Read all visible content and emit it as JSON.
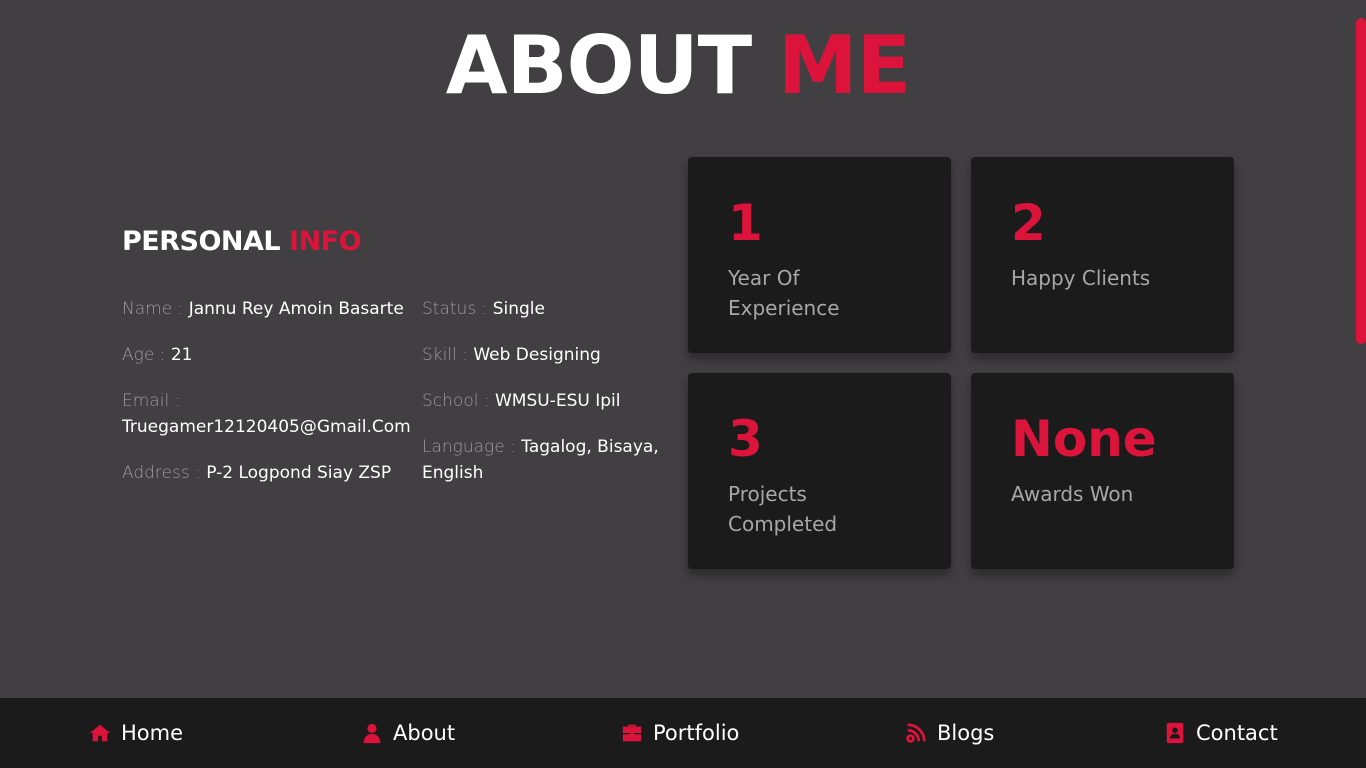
{
  "title": {
    "part1": "ABOUT",
    "part2": "ME"
  },
  "personal_info": {
    "heading_part1": "PERSONAL",
    "heading_part2": "INFO",
    "left": [
      {
        "key": "Name :",
        "value": "Jannu Rey Amoin Basarte"
      },
      {
        "key": "Age :",
        "value": "21"
      },
      {
        "key": "Email :",
        "value": "Truegamer12120405@Gmail.Com"
      },
      {
        "key": "Address :",
        "value": "P-2 Logpond Siay ZSP"
      }
    ],
    "right": [
      {
        "key": "Status :",
        "value": "Single"
      },
      {
        "key": "Skill :",
        "value": "Web Designing"
      },
      {
        "key": "School :",
        "value": "WMSU-ESU Ipil"
      },
      {
        "key": "Language :",
        "value": "Tagalog, Bisaya, English"
      }
    ]
  },
  "stats": [
    {
      "number": "1",
      "label": "Year Of Experience"
    },
    {
      "number": "2",
      "label": "Happy Clients"
    },
    {
      "number": "3",
      "label": "Projects Completed"
    },
    {
      "number": "None",
      "label": "Awards Won"
    }
  ],
  "nav": [
    {
      "label": "Home",
      "icon": "home-icon"
    },
    {
      "label": "About",
      "icon": "user-icon"
    },
    {
      "label": "Portfolio",
      "icon": "briefcase-icon"
    },
    {
      "label": "Blogs",
      "icon": "blog-icon"
    },
    {
      "label": "Contact",
      "icon": "address-book-icon"
    }
  ],
  "colors": {
    "accent": "#dc143c",
    "background": "#413f41",
    "card": "#1c1b1c"
  }
}
